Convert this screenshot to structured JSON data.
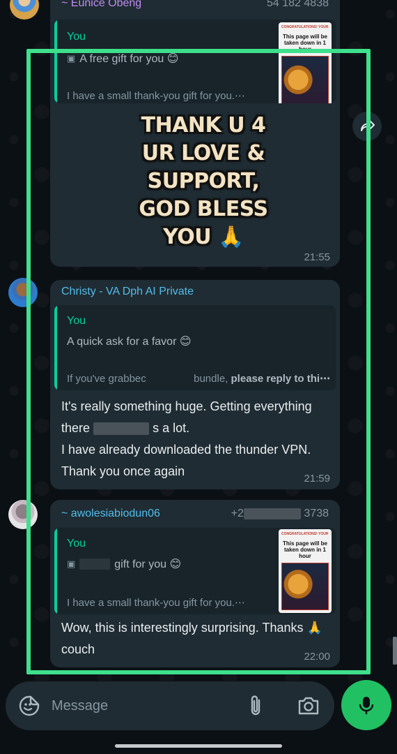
{
  "colors": {
    "background": "#0b1014",
    "bubble": "#1f2c33",
    "quote_accent": "#06cf9c",
    "highlight": "#3ee08c",
    "mic_button": "#21c063"
  },
  "messages": [
    {
      "sender": "~ Eunice Obeng",
      "phone": "54 182 4838",
      "quote": {
        "author": "You",
        "title": "A free gift for you 😊",
        "body": "I have a small thank-you gift for you.⋯"
      },
      "sticker_lines": [
        "THANK U 4",
        "UR LOVE &",
        "SUPPORT,",
        "GOD BLESS",
        "YOU"
      ],
      "sticker_emoji": "🙏",
      "time": "21:55"
    },
    {
      "sender": "Christy - VA Dph AI Private",
      "quote": {
        "author": "You",
        "title": "A quick ask for a favor 😊",
        "body_part1": "If you've grabbec",
        "body_part2": "bundle, ",
        "body_bold": "please reply to thi⋯"
      },
      "text_line1": "It's really something huge. Getting everything",
      "text_line2a": "there",
      "text_line2b": "s a lot.",
      "text_line3": "I have already downloaded the thunder VPN.",
      "text_line4": "Thank you once again",
      "time": "21:59"
    },
    {
      "sender": "~ awolesiabiodun06",
      "phone_prefix": "+2",
      "phone_suffix": "3738",
      "quote": {
        "author": "You",
        "title": "gift for you 😊",
        "body": "I have a small thank-you gift for you.⋯"
      },
      "text_line1": "Wow, this is interestingly surprising. Thanks 🙏",
      "text_line2": "couch",
      "time": "22:00"
    }
  ],
  "poster": {
    "top": "CONGRATULATIONS! YOUR",
    "title": "This page will be taken down in 1 hour"
  },
  "composer": {
    "placeholder": "Message"
  },
  "icons": {
    "emoji": "sticker-smile-icon",
    "attach": "paperclip-icon",
    "camera": "camera-icon",
    "mic": "microphone-icon",
    "forward": "forward-icon"
  }
}
